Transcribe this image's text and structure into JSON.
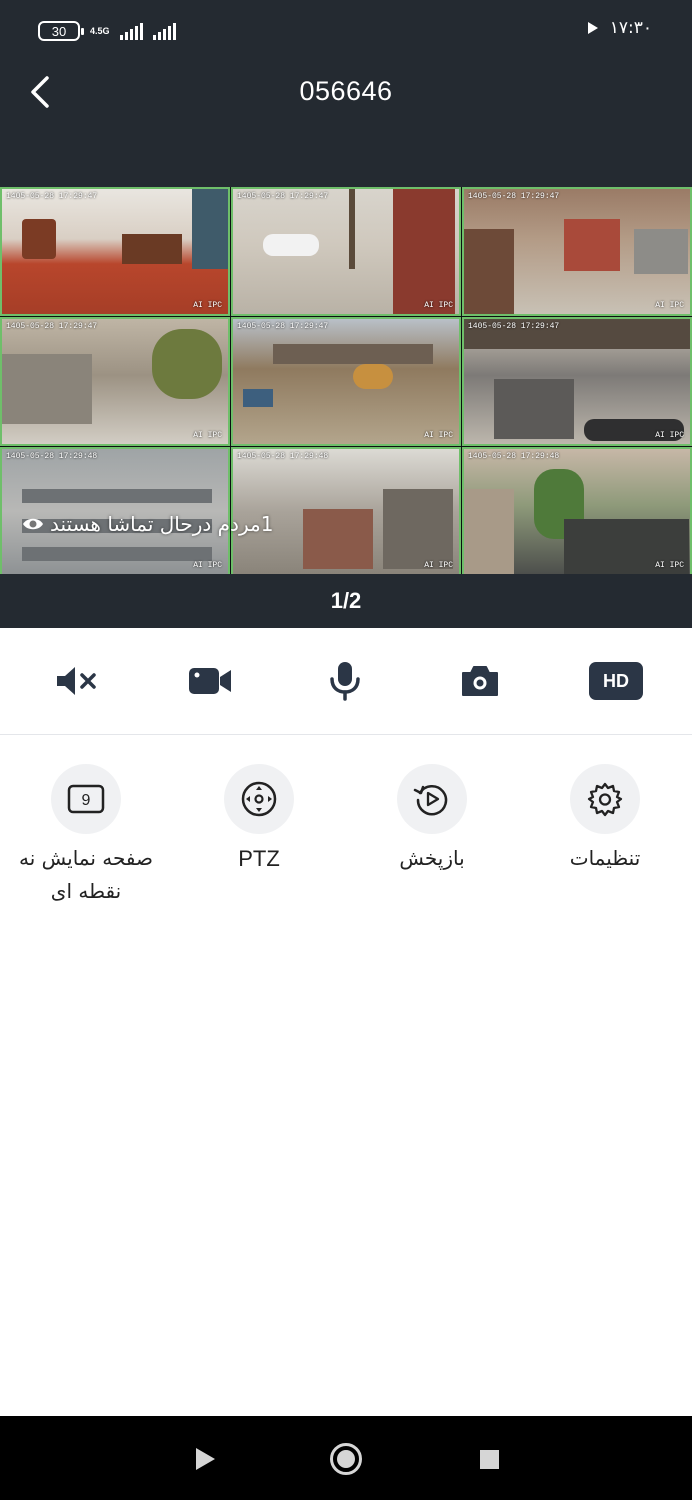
{
  "status_bar": {
    "battery": "30",
    "network": "4.5G",
    "time": "۱۷:۳۰"
  },
  "header": {
    "title": "056646"
  },
  "grid": {
    "cameras": [
      {
        "timestamp": "1405-05-28 17:29:47",
        "watermark": "AI IPC"
      },
      {
        "timestamp": "1405-05-28 17:29:47",
        "watermark": "AI IPC"
      },
      {
        "timestamp": "1405-05-28 17:29:47",
        "watermark": "AI IPC"
      },
      {
        "timestamp": "1405-05-28 17:29:47",
        "watermark": "AI IPC"
      },
      {
        "timestamp": "1405-05-28 17:29:47",
        "watermark": "AI IPC"
      },
      {
        "timestamp": "1405-05-28 17:29:47",
        "watermark": "AI IPC"
      },
      {
        "timestamp": "1405-05-28 17:29:48",
        "watermark": "AI IPC"
      },
      {
        "timestamp": "1405-05-28 17:29:48",
        "watermark": "AI IPC"
      },
      {
        "timestamp": "1405-05-28 17:29:48",
        "watermark": "AI IPC"
      }
    ],
    "viewers_text": "1مردم درحال تماشا هستند",
    "page_indicator": "1/2"
  },
  "toolbar": {
    "hd_label": "HD",
    "icons": [
      "mute-icon",
      "record-video-icon",
      "microphone-icon",
      "snapshot-camera-icon"
    ]
  },
  "features": {
    "settings_label": "تنظیمات",
    "playback_label": "بازپخش",
    "ptz_label": "PTZ",
    "nine_view_label": "صفحه نمایش نه نقطه ای",
    "nine_view_digit": "9"
  },
  "colors": {
    "header_bg": "#242a31",
    "accent_dark": "#2b3646",
    "tile_border": "#6fbf6a"
  }
}
